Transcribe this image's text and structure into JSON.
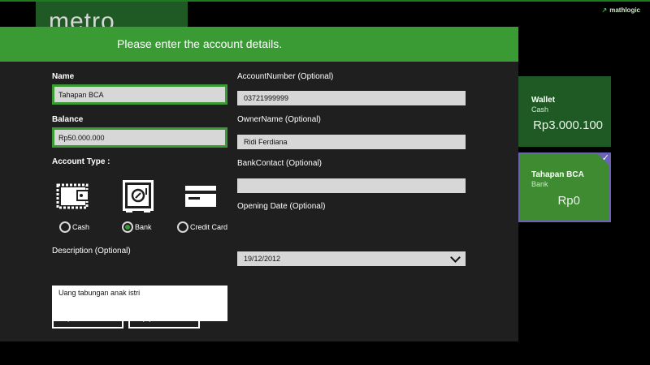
{
  "app": {
    "brand_text": "metro",
    "brand_small": "mathlogic"
  },
  "dialog": {
    "header": "Please enter the account details.",
    "name_label": "Name",
    "name_value": "Tahapan BCA",
    "balance_label": "Balance",
    "balance_value": "Rp50.000.000",
    "account_type_label": "Account Type :",
    "account_types": {
      "cash": "Cash",
      "bank": "Bank",
      "credit": "Credit Card"
    },
    "description_label": "Description (Optional)",
    "description_value": "Uang tabungan anak istri",
    "account_number_label": "AccountNumber (Optional)",
    "account_number_value": "03721999999",
    "owner_label": "OwnerName (Optional)",
    "owner_value": "Ridi Ferdiana",
    "bank_contact_label": "BankContact (Optional)",
    "bank_contact_value": "",
    "opening_date_label": "Opening Date (Optional)",
    "opening_date_value": "19/12/2012",
    "submit_label": "Submit",
    "cancel_label": "Cancel"
  },
  "tiles": {
    "wallet": {
      "title": "Wallet",
      "subtitle": "Cash",
      "amount": "Rp3.000.100"
    },
    "bca": {
      "title": "Tahapan BCA",
      "subtitle": "Bank",
      "amount": "Rp0"
    }
  },
  "colors": {
    "accent": "#3a9b35",
    "dark_tile": "#1f5a24",
    "selected_tile": "#3f8b31",
    "selection": "#6c62b8"
  }
}
